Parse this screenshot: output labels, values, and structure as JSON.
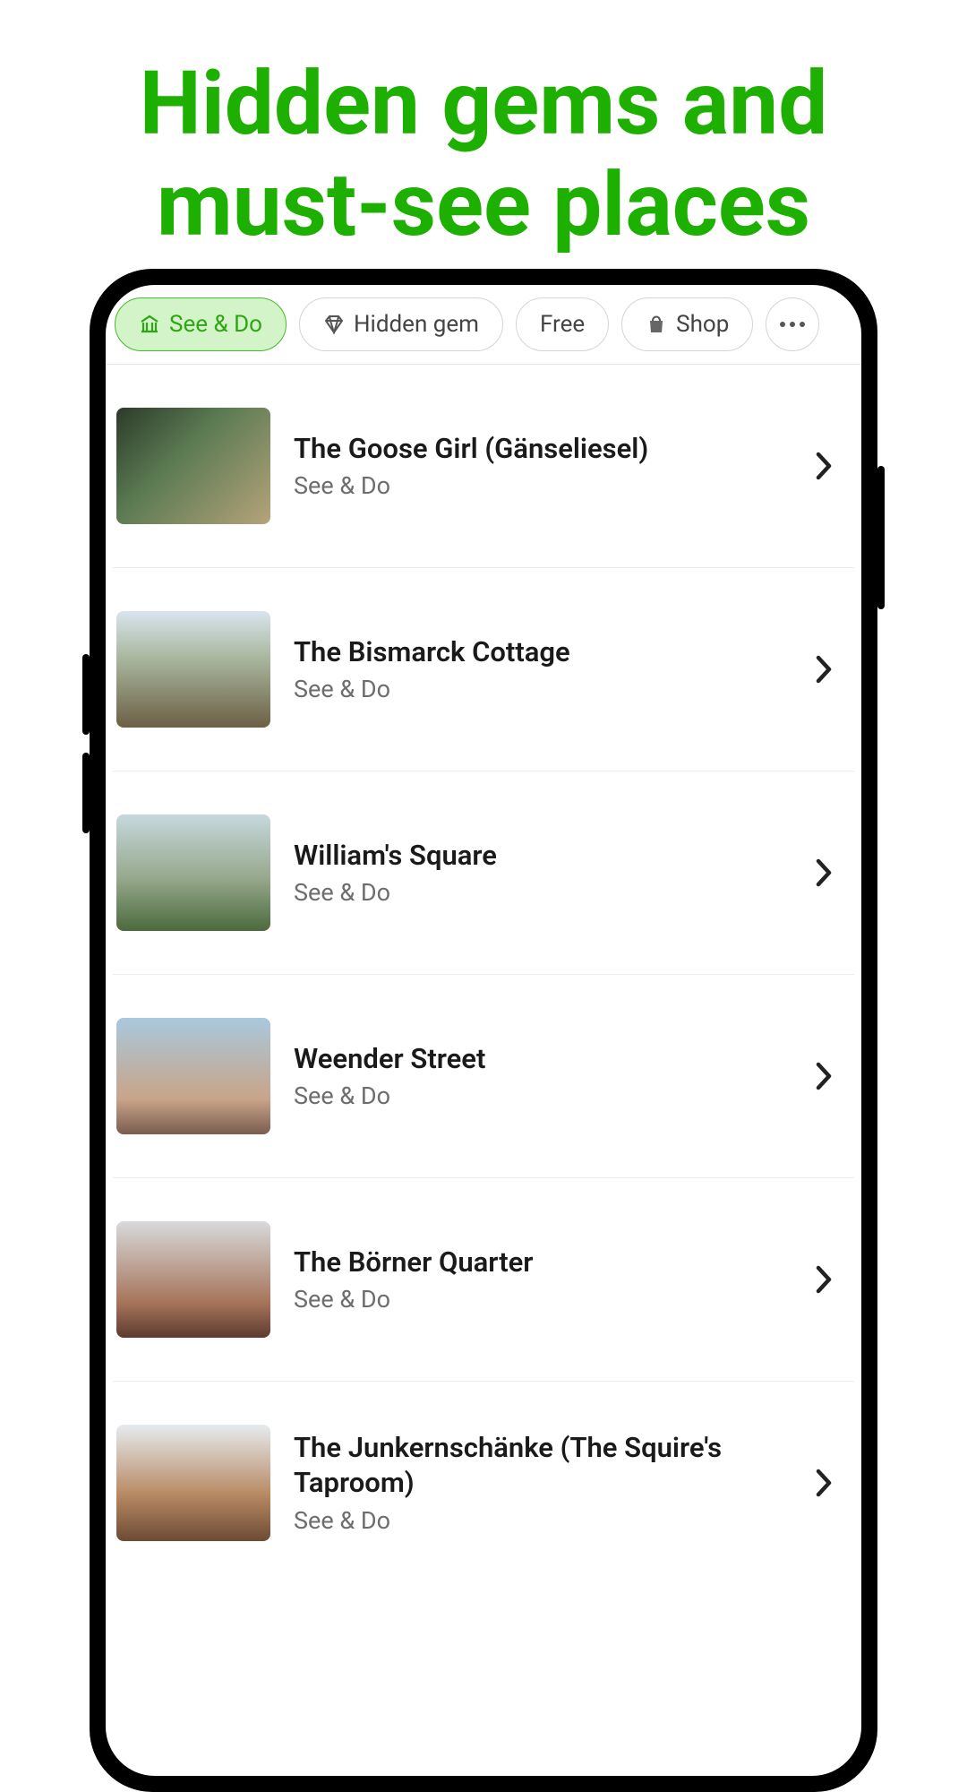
{
  "headline": "Hidden gems and must-see places",
  "filters": {
    "see_do": "See & Do",
    "hidden_gem": "Hidden gem",
    "free": "Free",
    "shop": "Shop"
  },
  "places": [
    {
      "title": "The Goose Girl (Gänseliesel)",
      "category": "See & Do"
    },
    {
      "title": "The Bismarck Cottage",
      "category": "See & Do"
    },
    {
      "title": "William's Square",
      "category": "See & Do"
    },
    {
      "title": "Weender Street",
      "category": "See & Do"
    },
    {
      "title": "The Börner Quarter",
      "category": "See & Do"
    },
    {
      "title": "The Junkernschänke (The Squire's Taproom)",
      "category": "See & Do"
    }
  ]
}
